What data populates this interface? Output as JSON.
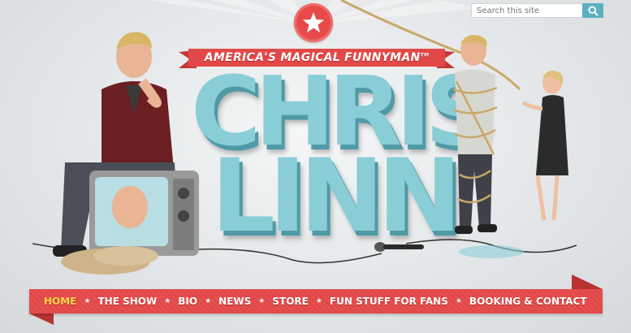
{
  "search": {
    "placeholder": "Search this site",
    "icon": "search-icon"
  },
  "header": {
    "tagline": "AMERICA'S MAGICAL FUNNYMAN",
    "trademark": "TM",
    "name_line1": "CHRIS",
    "name_line2": "LINN",
    "medallion_icon": "star-icon"
  },
  "nav": {
    "items": [
      {
        "label": "HOME",
        "active": true
      },
      {
        "label": "THE SHOW",
        "active": false
      },
      {
        "label": "BIO",
        "active": false
      },
      {
        "label": "NEWS",
        "active": false
      },
      {
        "label": "STORE",
        "active": false
      },
      {
        "label": "FUN STUFF FOR FANS",
        "active": false
      },
      {
        "label": "BOOKING & CONTACT",
        "active": false
      }
    ],
    "separator": "★"
  },
  "colors": {
    "accent": "#e34848",
    "brand_blue": "#89cdd6",
    "active_nav": "#ffd64a",
    "search_button": "#5ab0bf"
  }
}
